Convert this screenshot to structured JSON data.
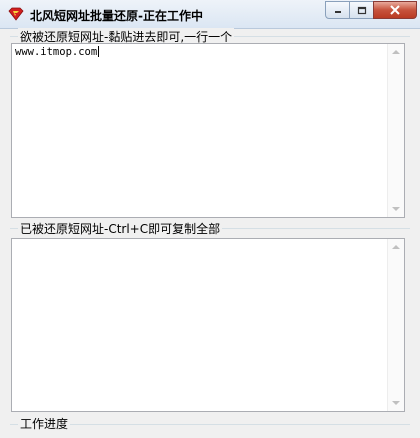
{
  "window": {
    "title": "北风短网址批量还原-正在工作中",
    "icon": "superman-shield-icon",
    "controls": [
      "minimize-icon",
      "maximize-icon",
      "close-icon"
    ]
  },
  "input_group": {
    "label": "欲被还原短网址-黏贴进去即可,一行一个",
    "value": "www.itmop.com"
  },
  "output_group": {
    "label": "已被还原短网址-Ctrl+C即可复制全部",
    "value": ""
  },
  "progress_group": {
    "label": "工作进度"
  }
}
